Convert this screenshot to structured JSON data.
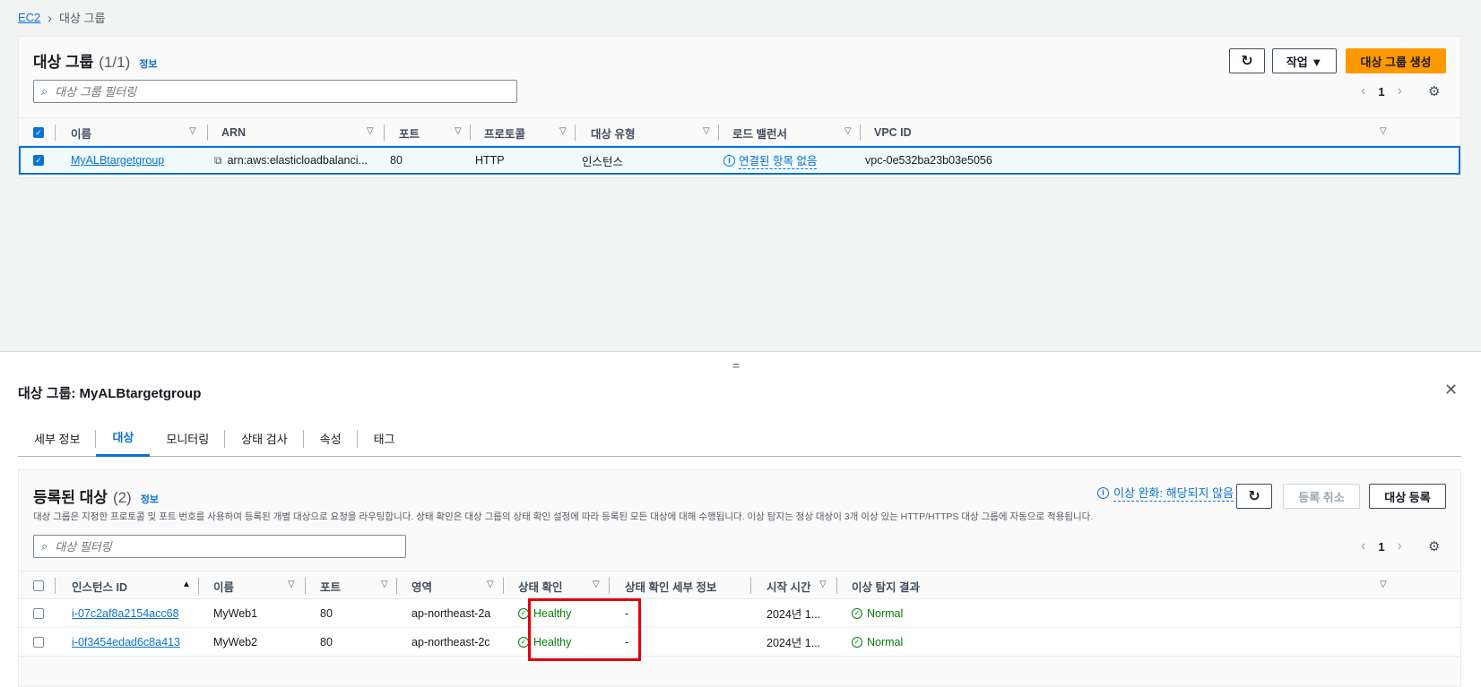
{
  "breadcrumb": {
    "root": "EC2",
    "current": "대상 그룹"
  },
  "top_panel": {
    "title": "대상 그룹",
    "count": "(1/1)",
    "info": "정보",
    "refresh_icon": "refresh-icon",
    "actions_label": "작업 ▼",
    "create_label": "대상 그룹 생성",
    "search_placeholder": "대상 그룹 필터링",
    "page": "1",
    "columns": [
      "이름",
      "ARN",
      "포트",
      "프로토콜",
      "대상 유형",
      "로드 밸런서",
      "VPC ID"
    ],
    "rows": [
      {
        "name": "MyALBtargetgroup",
        "arn": "arn:aws:elasticloadbalanci...",
        "port": "80",
        "protocol": "HTTP",
        "target_type": "인스턴스",
        "load_balancer": "연결된 항목 없음",
        "vpc_id": "vpc-0e532ba23b03e5056"
      }
    ]
  },
  "detail": {
    "title": "대상 그룹: MyALBtargetgroup",
    "tabs": [
      "세부 정보",
      "대상",
      "모니터링",
      "상태 검사",
      "속성",
      "태그"
    ],
    "active_tab": "대상"
  },
  "registered": {
    "title": "등록된 대상",
    "count": "(2)",
    "info": "정보",
    "anomaly_label": "이상 완화: 해당되지 않음",
    "deregister_label": "등록 취소",
    "register_label": "대상 등록",
    "description": "대상 그룹은 지정한 프로토콜 및 포트 번호를 사용하여 등록된 개별 대상으로 요청을 라우팅합니다. 상태 확인은 대상 그룹의 상태 확인 설정에 따라 등록된 모든 대상에 대해 수행됩니다. 이상 탐지는 정상 대상이 3개 이상 있는 HTTP/HTTPS 대상 그룹에 자동으로 적용됩니다.",
    "search_placeholder": "대상 필터링",
    "page": "1",
    "columns": [
      "인스턴스 ID",
      "이름",
      "포트",
      "영역",
      "상태 확인",
      "상태 확인 세부 정보",
      "시작 시간",
      "이상 탐지 결과"
    ],
    "rows": [
      {
        "instance_id": "i-07c2af8a2154acc68",
        "name": "MyWeb1",
        "port": "80",
        "zone": "ap-northeast-2a",
        "health": "Healthy",
        "health_detail": "-",
        "launch_time": "2024년 1...",
        "anomaly": "Normal"
      },
      {
        "instance_id": "i-0f3454edad6c8a413",
        "name": "MyWeb2",
        "port": "80",
        "zone": "ap-northeast-2c",
        "health": "Healthy",
        "health_detail": "-",
        "launch_time": "2024년 1...",
        "anomaly": "Normal"
      }
    ]
  },
  "colors": {
    "link": "#0972d3",
    "primary": "#ff9900",
    "success": "#037f0c",
    "highlight": "#e3000f"
  }
}
